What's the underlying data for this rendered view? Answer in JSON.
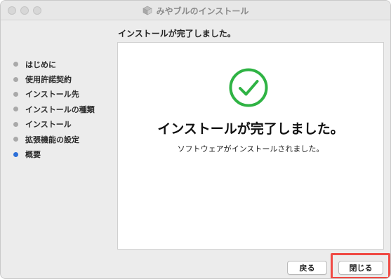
{
  "window": {
    "title": "みやブルのインストール"
  },
  "header": {
    "text": "インストールが完了しました。"
  },
  "sidebar": {
    "items": [
      {
        "label": "はじめに",
        "active": false
      },
      {
        "label": "使用許諾契約",
        "active": false
      },
      {
        "label": "インストール先",
        "active": false
      },
      {
        "label": "インストールの種類",
        "active": false
      },
      {
        "label": "インストール",
        "active": false
      },
      {
        "label": "拡張機能の設定",
        "active": false
      },
      {
        "label": "概要",
        "active": true
      }
    ]
  },
  "main": {
    "title": "インストールが完了しました。",
    "subtitle": "ソフトウェアがインストールされました。"
  },
  "buttons": {
    "back": "戻る",
    "close": "閉じる"
  },
  "colors": {
    "success_green": "#2fb344",
    "active_step": "#2c6fd8",
    "highlight": "#f04a44"
  },
  "icons": {
    "title": "package-icon",
    "status": "checkmark-circle-icon"
  }
}
